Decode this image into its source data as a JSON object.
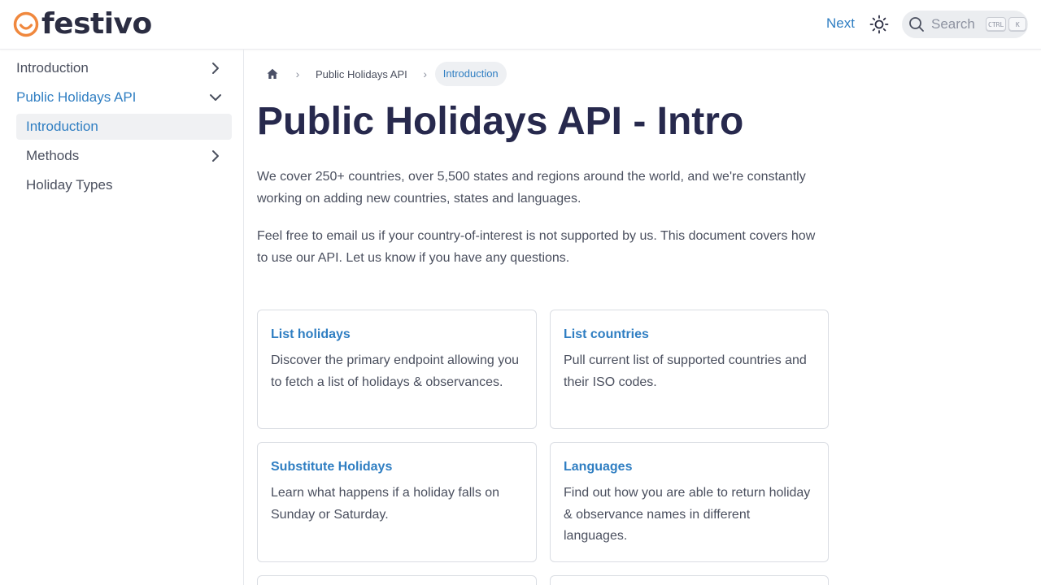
{
  "navbar": {
    "brand": "festivo",
    "next_label": "Next",
    "search_placeholder": "Search",
    "shortcut_keys": [
      "CTRL",
      "K"
    ]
  },
  "sidebar": {
    "items": [
      {
        "label": "Introduction"
      },
      {
        "label": "Public Holidays API"
      },
      {
        "label": "Introduction"
      },
      {
        "label": "Methods"
      },
      {
        "label": "Holiday Types"
      }
    ]
  },
  "breadcrumb": {
    "link": "Public Holidays API",
    "current": "Introduction"
  },
  "page": {
    "title": "Public Holidays API - Intro",
    "paragraphs": [
      "We cover 250+ countries, over 5,500 states and regions around the world, and we're constantly working on adding new countries, states and languages.",
      "Feel free to email us if your country-of-interest is not supported by us. This document covers how to use our API. Let us know if you have any questions."
    ]
  },
  "cards": [
    {
      "title": "List holidays",
      "desc": "Discover the primary endpoint allowing you to fetch a list of holidays & observances."
    },
    {
      "title": "List countries",
      "desc": "Pull current list of supported countries and their ISO codes."
    },
    {
      "title": "Substitute Holidays",
      "desc": "Learn what happens if a holiday falls on Sunday or Saturday."
    },
    {
      "title": "Languages",
      "desc": "Find out how you are able to return holiday & observance names in different languages."
    }
  ],
  "colors": {
    "accent": "#2f7ec2",
    "title": "#27294d",
    "logo_orange": "#f0883e",
    "active_bg": "#f0f1f3"
  },
  "icons": [
    "festivo-logo-icon",
    "sun-icon",
    "search-icon",
    "chevron-right-icon",
    "chevron-down-icon",
    "home-icon"
  ]
}
